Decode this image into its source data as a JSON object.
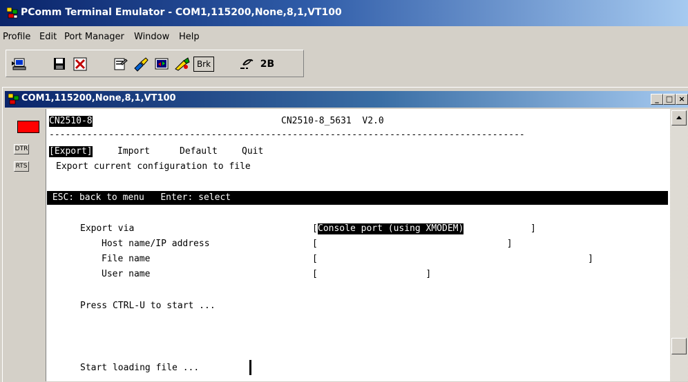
{
  "app_title": "PComm Terminal Emulator - COM1,115200,None,8,1,VT100",
  "menu": [
    {
      "label": "Profile"
    },
    {
      "label": "Edit"
    },
    {
      "label": "Port Manager"
    },
    {
      "label": "Window"
    },
    {
      "label": "Help"
    }
  ],
  "toolbar": {
    "brk_label": "Brk",
    "twob_label": "2B"
  },
  "session": {
    "title": "COM1,115200,None,8,1,VT100",
    "minimize": "_",
    "restore": "□",
    "close": "×",
    "dtr_label": "DTR",
    "rts_label": "RTS",
    "led_color": "#ff0000"
  },
  "terminal": {
    "device": "CN2510-8",
    "version_line": "CN2510-8_5631  V2.0",
    "separator": "----------------------------------------------------------------------------------------",
    "menu_export": "[Export]",
    "menu_import": "Import",
    "menu_default": "Default",
    "menu_quit": "Quit",
    "description": "Export current configuration to file",
    "help_bar": " ESC: back to menu   Enter: select",
    "export_via_label": "Export via",
    "export_via_open": "[",
    "export_via_value": "Console port (using XMODEM)",
    "export_via_close": "]",
    "host_label": "Host name/IP address",
    "host_value": "[                                   ]",
    "file_label": "File name",
    "file_value": "[                                                  ]",
    "user_label": "User name",
    "user_value": "[                    ]",
    "press_hint": "Press CTRL-U to start ...",
    "status": "Start loading file ..."
  }
}
